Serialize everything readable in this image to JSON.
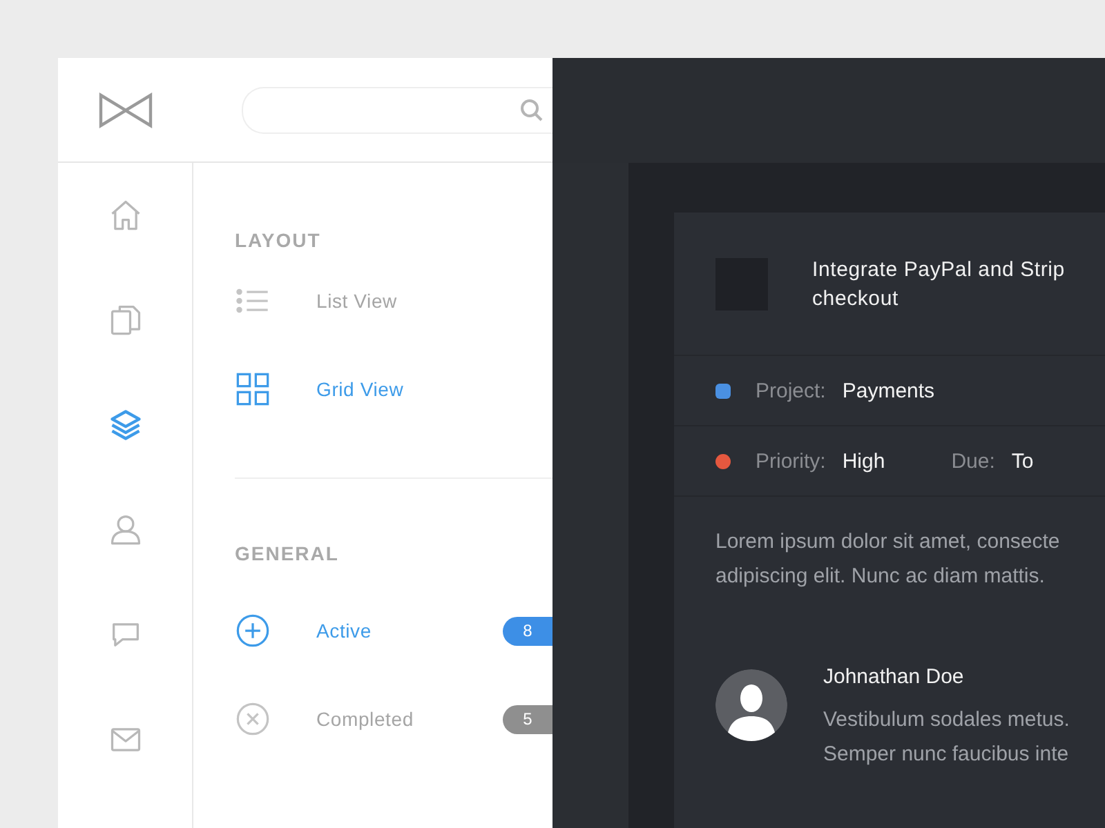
{
  "rail": [
    {
      "kind": "home",
      "selected": false
    },
    {
      "kind": "documents",
      "selected": false
    },
    {
      "kind": "layers",
      "selected": true
    },
    {
      "kind": "user",
      "selected": false
    },
    {
      "kind": "chat",
      "selected": false
    },
    {
      "kind": "mail",
      "selected": false
    }
  ],
  "sections": [
    {
      "title": "LAYOUT",
      "items": [
        {
          "kind": "list",
          "label": "List View",
          "selected": false
        },
        {
          "kind": "grid",
          "label": "Grid View",
          "selected": true
        }
      ]
    },
    {
      "title": "GENERAL",
      "items": [
        {
          "kind": "plus",
          "label": "Active",
          "selected": true,
          "count": "8"
        },
        {
          "kind": "cross",
          "label": "Completed",
          "selected": false,
          "count": "5"
        }
      ]
    }
  ],
  "task": {
    "checked": false,
    "title": "Integrate PayPal and Strip checkout",
    "meta": [
      {
        "color": "#4a90e2",
        "fields": [
          {
            "label": "Project:",
            "value": "Payments"
          }
        ]
      },
      {
        "color": "#e5583f",
        "fields": [
          {
            "label": "Priority:",
            "value": "High"
          },
          {
            "label": "Due:",
            "value": "To"
          }
        ]
      }
    ],
    "description": "Lorem ipsum dolor sit amet, consecte adipiscing elit. Nunc ac diam mattis.",
    "comment": {
      "author": "Johnathan Doe",
      "text": "Vestibulum sodales metus. Semper nunc faucibus inte"
    }
  }
}
